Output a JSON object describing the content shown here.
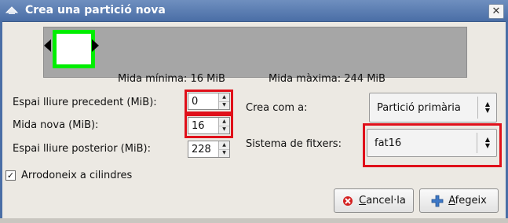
{
  "window": {
    "title": "Crea una partició nova",
    "close_glyph": "✕"
  },
  "partition_bar": {
    "min_size_label": "Mida mínima: 16 MiB",
    "max_size_label": "Mida màxima: 244 MiB",
    "selected_fraction": 0.07
  },
  "fields": {
    "free_before": {
      "label": "Espai lliure precedent (MiB):",
      "value": "0"
    },
    "new_size": {
      "label": "Mida nova (MiB):",
      "value": "16"
    },
    "free_after": {
      "label": "Espai lliure posterior (MiB):",
      "value": "228"
    },
    "create_as": {
      "label": "Crea com a:",
      "value": "Partició primària"
    },
    "filesystem": {
      "label": "Sistema de fitxers:",
      "value": "fat16"
    }
  },
  "round_cylinders": {
    "label": "Arrodoneix a cilindres",
    "checked": true,
    "check_glyph": "✓"
  },
  "buttons": {
    "cancel": {
      "mnemonic": "C",
      "rest": "ancel·la",
      "icon": "cancel-icon"
    },
    "add": {
      "mnemonic": "A",
      "rest": "fegeix",
      "icon": "add-icon"
    }
  },
  "colors": {
    "highlight": "#e0101a",
    "selected_partition": "#00ee00",
    "unallocated": "#a6a6a6"
  }
}
